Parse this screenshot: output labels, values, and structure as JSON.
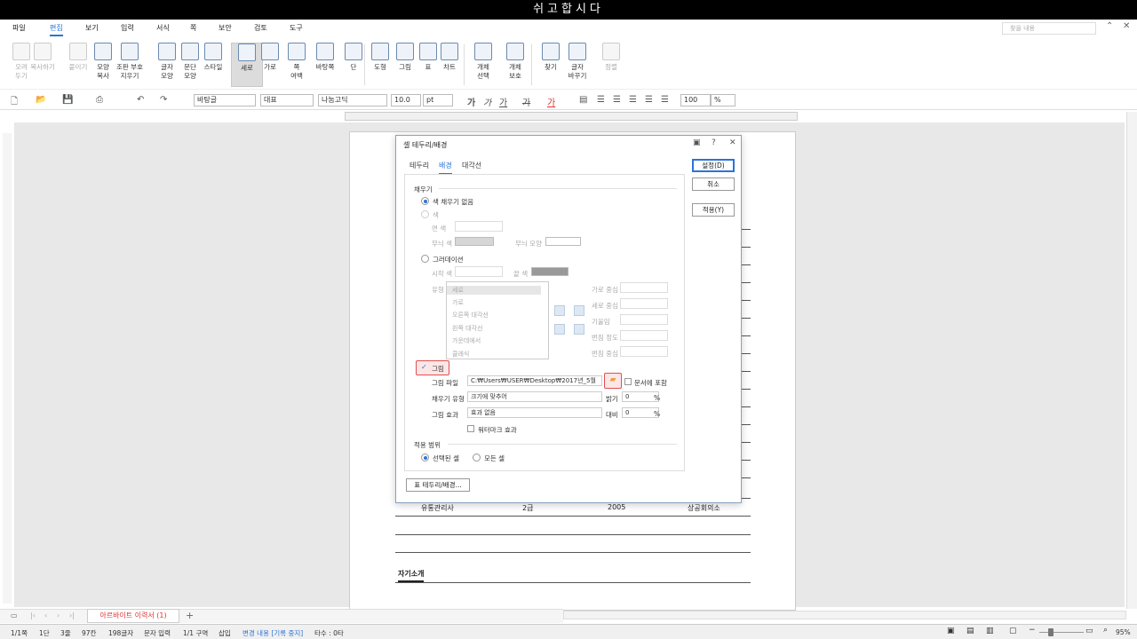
{
  "title": "쉬고합시다",
  "menu": {
    "items": [
      "파일",
      "편집",
      "보기",
      "입력",
      "서식",
      "쪽",
      "보안",
      "검토",
      "도구"
    ],
    "active": "편집",
    "search_placeholder": "찾을 내용"
  },
  "ribbon": {
    "buttons": [
      {
        "label": "오려\n두기",
        "icon": "scissors-icon",
        "disabled": true
      },
      {
        "label": "복사하기",
        "icon": "copy-icon",
        "disabled": true
      },
      {
        "label": "붙이기",
        "icon": "paste-icon",
        "disabled": true
      },
      {
        "label": "모양\n복사",
        "icon": "format-painter-icon",
        "disabled": false
      },
      {
        "label": "조판 부호\n지우기",
        "icon": "clear-codes-icon",
        "disabled": false
      },
      {
        "label": "글자\n모양",
        "icon": "char-shape-icon",
        "disabled": false
      },
      {
        "label": "문단\n모양",
        "icon": "para-shape-icon",
        "disabled": false
      },
      {
        "label": "스타일",
        "icon": "style-icon",
        "disabled": false
      },
      {
        "label": "세로",
        "icon": "portrait-icon",
        "disabled": false,
        "selected": true
      },
      {
        "label": "가로",
        "icon": "landscape-icon",
        "disabled": false
      },
      {
        "label": "쪽\n여백",
        "icon": "margin-icon",
        "disabled": false
      },
      {
        "label": "바탕쪽",
        "icon": "master-page-icon",
        "disabled": false
      },
      {
        "label": "단",
        "icon": "column-icon",
        "disabled": false
      },
      {
        "label": "도형",
        "icon": "shape-icon",
        "disabled": false
      },
      {
        "label": "그림",
        "icon": "picture-icon",
        "disabled": false
      },
      {
        "label": "표",
        "icon": "table-icon",
        "disabled": false
      },
      {
        "label": "차트",
        "icon": "chart-icon",
        "disabled": false
      },
      {
        "label": "개체\n선택",
        "icon": "object-select-icon",
        "disabled": false
      },
      {
        "label": "개체\n보호",
        "icon": "object-protect-icon",
        "disabled": false
      },
      {
        "label": "찾기",
        "icon": "find-icon",
        "disabled": false
      },
      {
        "label": "글자\n바꾸기",
        "icon": "replace-icon",
        "disabled": false
      },
      {
        "label": "정렬",
        "icon": "sort-icon",
        "disabled": true
      }
    ]
  },
  "format": {
    "style": "바탕글",
    "lang": "대표",
    "font": "나눔고딕",
    "size": "10.0",
    "unit": "pt",
    "zoom": "100",
    "zoom_unit": "%"
  },
  "document": {
    "row": [
      "유통관리사",
      "2급",
      "2005",
      "상공회의소"
    ],
    "section_heading": "자기소개"
  },
  "dialog": {
    "title": "셀 테두리/배경",
    "tabs": [
      "테두리",
      "배경",
      "대각선"
    ],
    "active_tab": "배경",
    "fill_group": "채우기",
    "no_fill": "색 채우기 없음",
    "color": "색",
    "face_color": "면 색",
    "pattern_color": "무늬 색",
    "pattern_shape": "무늬 모양",
    "gradation": "그러데이션",
    "start_color": "시작 색",
    "end_color": "끝 색",
    "type_label": "유형",
    "gradient_types": [
      "세로",
      "가로",
      "오른쪽 대각선",
      "왼쪽 대각선",
      "가운데에서",
      "클래식"
    ],
    "h_center": "가로 중심",
    "v_center": "세로 중심",
    "tilt": "기울임",
    "blur_degree": "번짐 정도",
    "blur_center": "번짐 중심",
    "picture_check": "그림",
    "picture_file_label": "그림 파일",
    "picture_file": "C:₩Users₩USER₩Desktop₩2017년_5월",
    "include_in_doc": "문서에 포함",
    "fill_type_label": "채우기 유형",
    "fill_type": "크기에 맞추어",
    "brightness_label": "밝기",
    "brightness": "0",
    "picture_effect_label": "그림 효과",
    "picture_effect": "효과 없음",
    "contrast_label": "대비",
    "contrast": "0",
    "percent": "%",
    "watermark": "워터마크 효과",
    "apply_range": "적용 범위",
    "selected_cells": "선택된 셀",
    "all_cells": "모든 셀",
    "table_border_btn": "표 테두리/배경...",
    "ok": "설정(D)",
    "cancel": "취소",
    "apply": "적용(Y)"
  },
  "tab": {
    "doc_name": "아르바이트 이력서 (1)",
    "add": "+"
  },
  "status": {
    "page": "1/1쪽",
    "col": "1단",
    "line": "3줄",
    "chars_col": "97칸",
    "chars": "198글자",
    "mode": "문자 입력",
    "section": "1/1 구역",
    "insert": "삽입",
    "track": "변경 내용 [기록 중지]",
    "typing": "타수 : 0타",
    "zoom": "95%"
  },
  "colors": {
    "accent": "#2b74d8",
    "highlight_red": "#e05050"
  }
}
